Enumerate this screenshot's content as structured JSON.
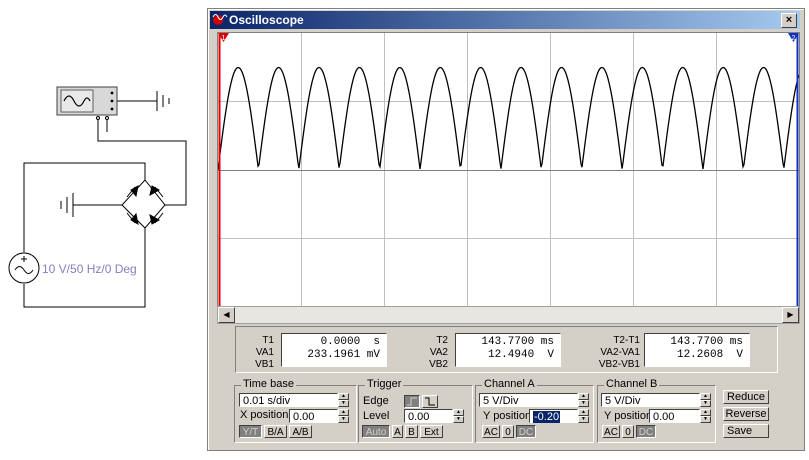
{
  "source": {
    "label": "10 V/50 Hz/0 Deg"
  },
  "window": {
    "title": "Oscilloscope",
    "close_glyph": "×",
    "icon": "oscilloscope-icon"
  },
  "screen": {
    "marker_1": "1",
    "marker_2": "2",
    "waveform": {
      "type": "full-wave rectified sine",
      "cycles_visible": 14.377,
      "peak_fraction": 0.52
    }
  },
  "scrollbar": {
    "left_arrow": "◀",
    "right_arrow": "▶"
  },
  "readouts": {
    "t1": {
      "label": "T1",
      "value": "0.0000",
      "unit": "s"
    },
    "va1": {
      "label": "VA1",
      "value": "233.1961",
      "unit": "mV"
    },
    "vb1": {
      "label": "VB1"
    },
    "t2": {
      "label": "T2",
      "value": "143.7700",
      "unit": "ms"
    },
    "va2": {
      "label": "VA2",
      "value": "12.4940",
      "unit": "V"
    },
    "vb2": {
      "label": "VB2"
    },
    "t2t1": {
      "label": "T2-T1",
      "value": "143.7700",
      "unit": "ms"
    },
    "va2va1": {
      "label": "VA2-VA1",
      "value": "12.2608",
      "unit": "V"
    },
    "vb2vb1": {
      "label": "VB2-VB1"
    }
  },
  "timebase": {
    "title": "Time base",
    "value": "0.01 s/div",
    "xpos_label": "X position",
    "xpos_value": "0.00",
    "buttons": [
      "Y/T",
      "B/A",
      "A/B"
    ]
  },
  "trigger": {
    "title": "Trigger",
    "edge_label": "Edge",
    "level_label": "Level",
    "level_value": "0.00",
    "buttons": [
      "Auto",
      "A",
      "B",
      "Ext"
    ]
  },
  "channel_a": {
    "title": "Channel A",
    "value": "5  V/Div",
    "ypos_label": "Y position",
    "ypos_value": "-0.20",
    "buttons": [
      "AC",
      "0",
      "DC"
    ]
  },
  "channel_b": {
    "title": "Channel B",
    "value": "5  V/Div",
    "ypos_label": "Y position",
    "ypos_value": "0.00",
    "buttons": [
      "AC",
      "0",
      "DC"
    ]
  },
  "actions": {
    "reduce": "Reduce",
    "reverse": "Reverse",
    "save": "Save"
  },
  "colors": {
    "titlebar_start": "#0a246a",
    "titlebar_end": "#a6caf0",
    "cursor1": "#e00000",
    "cursor2": "#1030c0",
    "selection": "#0a246a",
    "source_label": "#8080c0"
  }
}
